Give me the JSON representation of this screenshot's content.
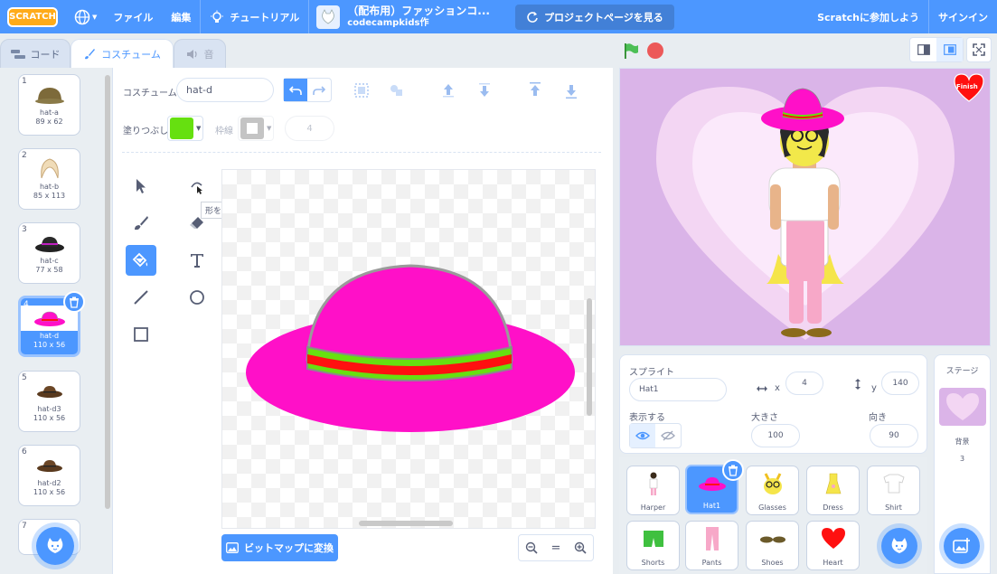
{
  "menu": {
    "logo": "SCRATCH",
    "file": "ファイル",
    "edit": "編集",
    "tutorials": "チュートリアル",
    "project_title": "（配布用）ファッションコ...",
    "project_author": "codecampkids作",
    "see_project_page": "プロジェクトページを見る",
    "join": "Scratchに参加しよう",
    "sign_in": "サインイン"
  },
  "tabs": {
    "code": "コード",
    "costumes": "コスチューム",
    "sounds": "音"
  },
  "costumes": [
    {
      "num": "1",
      "name": "hat-a",
      "size": "89 x 62"
    },
    {
      "num": "2",
      "name": "hat-b",
      "size": "85 x 113"
    },
    {
      "num": "3",
      "name": "hat-c",
      "size": "77 x 58"
    },
    {
      "num": "4",
      "name": "hat-d",
      "size": "110 x 56"
    },
    {
      "num": "5",
      "name": "hat-d3",
      "size": "110 x 56"
    },
    {
      "num": "6",
      "name": "hat-d2",
      "size": "110 x 56"
    },
    {
      "num": "7"
    }
  ],
  "paint": {
    "costume_label": "コスチューム",
    "costume_name": "hat-d",
    "fill_label": "塗りつぶし",
    "fill_color": "#66e010",
    "outline_label": "枠線",
    "outline_width": "4",
    "tooltip": "形を変える",
    "convert_button": "ビットマップに変換"
  },
  "sprite_info": {
    "sprite_label": "スプライト",
    "sprite_name": "Hat1",
    "x_label": "x",
    "x_value": "4",
    "y_label": "y",
    "y_value": "140",
    "show_label": "表示する",
    "size_label": "大きさ",
    "size_value": "100",
    "direction_label": "向き",
    "direction_value": "90"
  },
  "sprites": [
    {
      "name": "Harper"
    },
    {
      "name": "Hat1"
    },
    {
      "name": "Glasses"
    },
    {
      "name": "Dress"
    },
    {
      "name": "Shirt"
    },
    {
      "name": "Shorts"
    },
    {
      "name": "Pants"
    },
    {
      "name": "Shoes"
    },
    {
      "name": "Heart"
    }
  ],
  "stage": {
    "finish": "Finish",
    "pane_title": "ステージ",
    "backdrop_label": "背景",
    "backdrop_count": "3"
  },
  "colors": {
    "accent": "#4c97ff",
    "hat_pink": "#ff10c8",
    "hat_band_red": "#ff1010",
    "hat_band_green": "#66e010"
  }
}
